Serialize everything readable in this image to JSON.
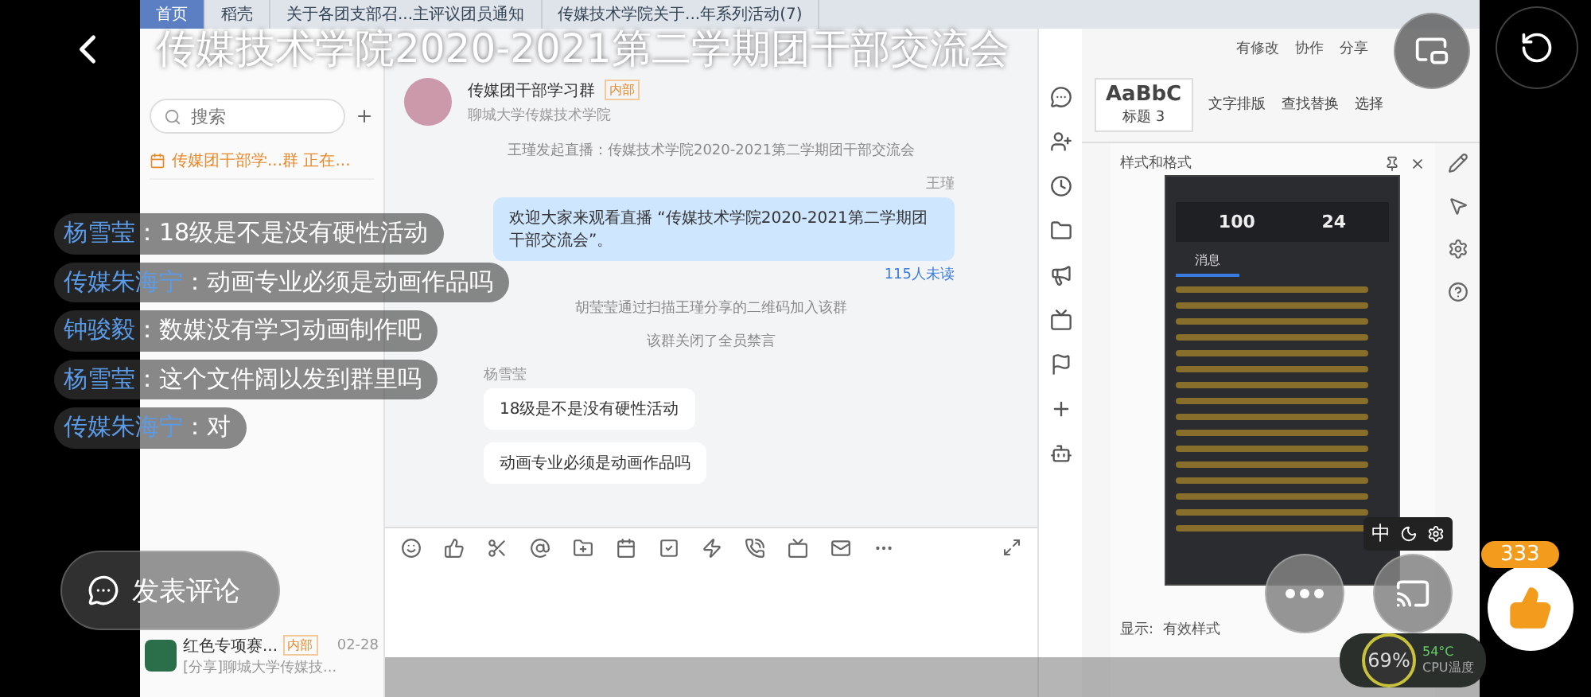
{
  "title": "传媒技术学院2020-2021第二学期团干部交流会",
  "browser_tabs": [
    {
      "label": "首页",
      "selected": true
    },
    {
      "label": "稻壳",
      "selected": false
    },
    {
      "label": "关于各团支部召...主评议团员通知",
      "selected": false
    },
    {
      "label": "传媒技术学院关于...年系列活动(7)",
      "selected": false
    }
  ],
  "chat_list": {
    "search": {
      "placeholder": "搜索"
    },
    "banner": "传媒团干部学...群 正在...",
    "items": [
      {
        "name": "红色专项赛...",
        "time": "02-28",
        "preview": "[分享]聊城大学传媒技...",
        "tag": "内部"
      }
    ]
  },
  "chat": {
    "group_name": "传媒团干部学习群",
    "group_tag": "内部",
    "group_org": "聊城大学传媒技术学院",
    "messages": [
      {
        "kind": "system",
        "text": "王瑾发起直播：传媒技术学院2020-2021第二学期团干部交流会"
      },
      {
        "kind": "own",
        "sender": "王瑾",
        "text": "欢迎大家来观看直播 “传媒技术学院2020-2021第二学期团干部交流会”。",
        "status": "115人未读"
      },
      {
        "kind": "system",
        "text": "胡莹莹通过扫描王瑾分享的二维码加入该群"
      },
      {
        "kind": "system",
        "text": "该群关闭了全员禁言"
      },
      {
        "kind": "other",
        "sender": "杨雪莹",
        "text": "18级是不是没有硬性活动"
      },
      {
        "kind": "other",
        "text": "动画专业必须是动画作品吗"
      }
    ]
  },
  "editor": {
    "ribbon": [
      "有修改",
      "协作",
      "分享"
    ],
    "style_preview": "AaBbC",
    "style_name": "标题 3",
    "tools": [
      "文字排版",
      "查找替换",
      "选择"
    ],
    "pane_title": "样式和格式",
    "show_label": "显示:",
    "show_value": "有效样式"
  },
  "live_panel": {
    "viewers": "100",
    "likes": "24",
    "tab": "消息"
  },
  "comments": [
    {
      "name": "杨雪莹",
      "text": "：18级是不是没有硬性活动"
    },
    {
      "name": "传媒朱海宁",
      "text": "：动画专业必须是动画作品吗"
    },
    {
      "name": "钟骏毅",
      "text": "：数媒没有学习动画制作吧"
    },
    {
      "name": "杨雪莹",
      "text": "：这个文件阔以发到群里吗"
    },
    {
      "name": "传媒朱海宁",
      "text": "：对"
    }
  ],
  "comment_button": "发表评论",
  "like_count": "333",
  "ime": "中",
  "cpu": {
    "load": "69",
    "unit": "%",
    "temp": "54°C",
    "label": "CPU温度"
  }
}
